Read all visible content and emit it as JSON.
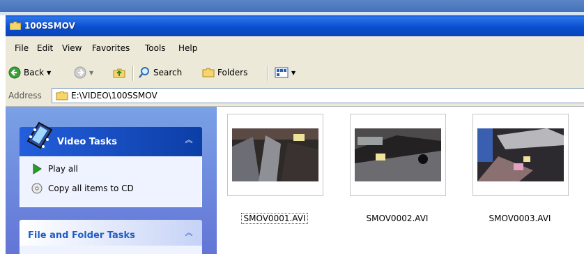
{
  "window": {
    "title": "100SSMOV"
  },
  "menu": [
    "File",
    "Edit",
    "View",
    "Favorites",
    "Tools",
    "Help"
  ],
  "toolbar": {
    "back": "Back",
    "search": "Search",
    "folders": "Folders"
  },
  "address": {
    "label": "Address",
    "value": "E:\\VIDEO\\100SSMOV"
  },
  "video_tasks": {
    "title": "Video Tasks",
    "items": [
      {
        "label": "Play all",
        "icon": "play-icon"
      },
      {
        "label": "Copy all items to CD",
        "icon": "cd-icon"
      }
    ]
  },
  "file_folder_tasks": {
    "title": "File and Folder Tasks"
  },
  "files": [
    {
      "name": "SMOV0001.AVI",
      "selected": true
    },
    {
      "name": "SMOV0002.AVI",
      "selected": false
    },
    {
      "name": "SMOV0003.AVI",
      "selected": false
    }
  ],
  "colors": {
    "title_blue": "#0a4fd0",
    "pane_blue": "#6f8fe0",
    "task_header": "#245edc"
  }
}
